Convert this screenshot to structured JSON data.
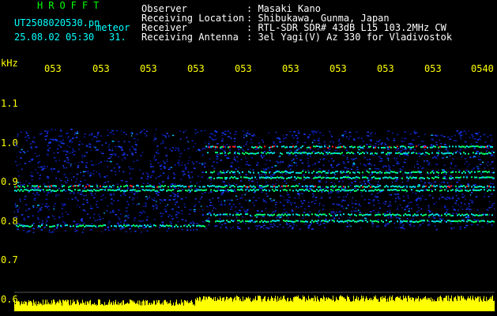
{
  "brand": "HROFFT",
  "file": {
    "name": "UT2508020530.pn",
    "tag": "meteor",
    "date_time": "25.08.02 05:30",
    "count": "31."
  },
  "header": {
    "rows": [
      {
        "label": "Observer",
        "value": ": Masaki Kano"
      },
      {
        "label": "Receiving Location",
        "value": ": Shibukawa, Gunma, Japan"
      },
      {
        "label": "Receiver",
        "value": ": RTL-SDR SDR# 43dB L15 103.2MHz CW"
      },
      {
        "label": "Receiving Antenna",
        "value": ": 3el Yagi(V) Az 330 for Vladivostok"
      }
    ]
  },
  "x_axis": {
    "ticks": [
      "053",
      "053",
      "053",
      "053",
      "053",
      "053",
      "053",
      "053",
      "053",
      "0540"
    ]
  },
  "y_axis": {
    "unit": "kHz",
    "ticks": [
      "1.1",
      "1.0",
      "0.9",
      "0.8",
      "0.7",
      "0.6"
    ]
  },
  "colors": {
    "bg": "#000000",
    "noise": "#0a1eb4",
    "echo": "#00ff66",
    "hot": "#ff2020",
    "meter": "#ffff00"
  }
}
